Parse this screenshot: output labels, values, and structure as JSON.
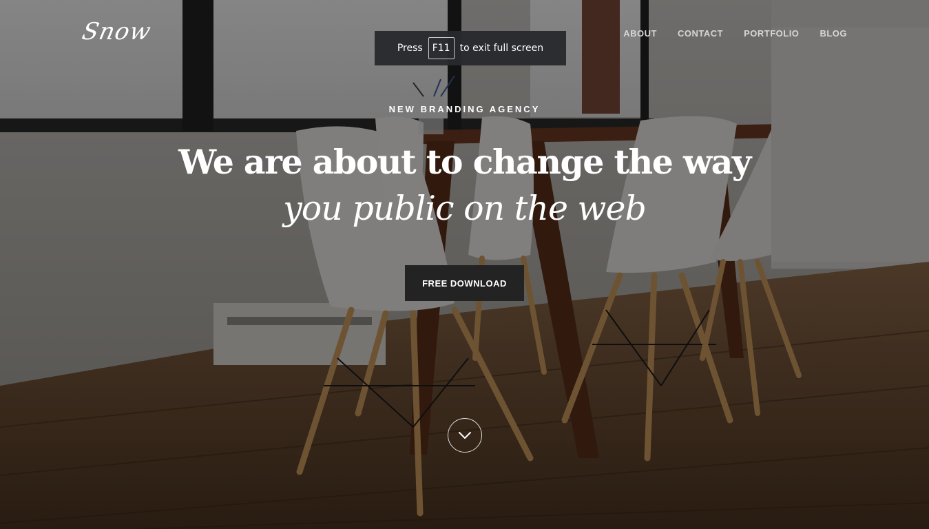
{
  "brand": {
    "logo_text": "Snow"
  },
  "nav": {
    "items": [
      {
        "label": "ABOUT"
      },
      {
        "label": "CONTACT"
      },
      {
        "label": "PORTFOLIO"
      },
      {
        "label": "BLOG"
      }
    ]
  },
  "fullscreen_notice": {
    "prefix": "Press",
    "key": "F11",
    "suffix": "to exit full screen"
  },
  "hero": {
    "eyebrow": "NEW BRANDING AGENCY",
    "headline_line1": "We are about to change the way",
    "headline_line2": "you public on the web",
    "cta_label": "FREE DOWNLOAD",
    "scroll_icon": "chevron-down-icon"
  },
  "colors": {
    "text": "#ffffff",
    "nav_text": "#d6d6d6",
    "button_bg": "#232323",
    "notice_bg": "#282a2e"
  }
}
